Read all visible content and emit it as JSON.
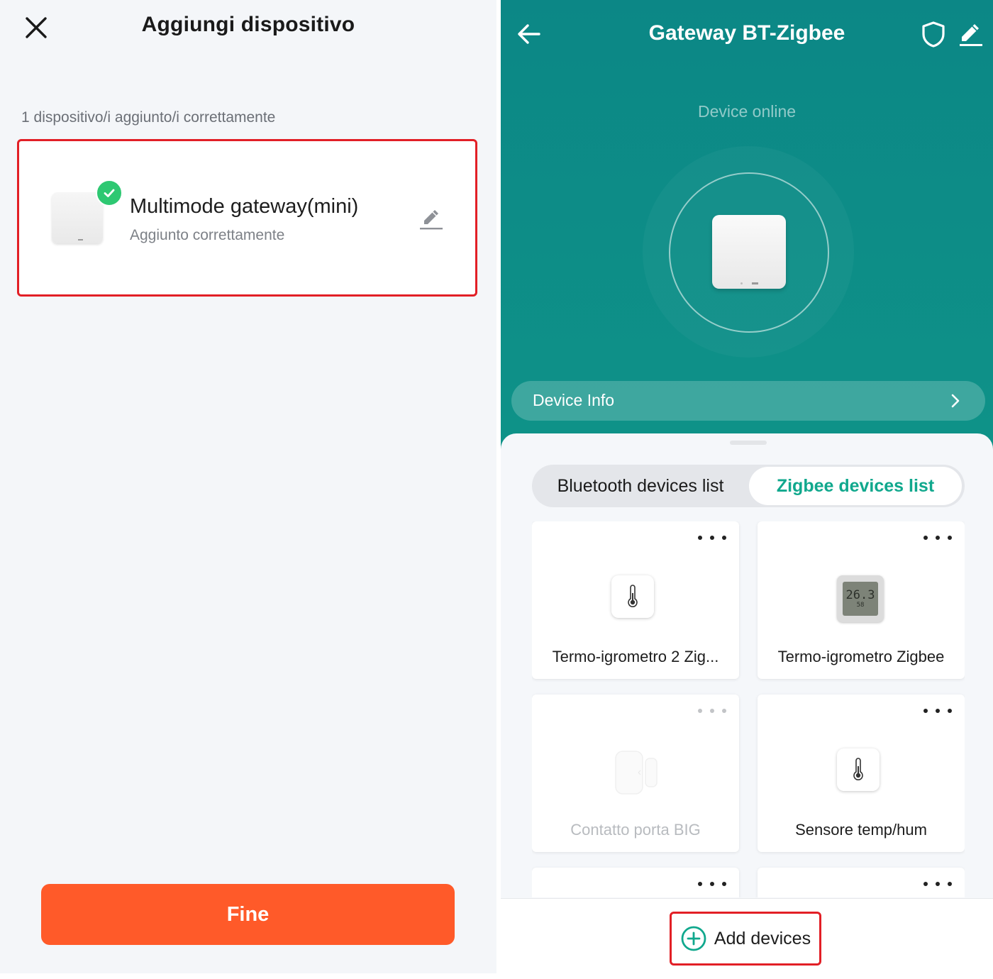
{
  "left_screen": {
    "title": "Aggiungi dispositivo",
    "close_icon": "close-icon",
    "success_message": "1 dispositivo/i aggiunto/i correttamente",
    "device": {
      "name": "Multimode gateway(mini)",
      "status": "Aggiunto correttamente",
      "badge_icon": "check-icon",
      "edit_icon": "pencil-icon"
    },
    "done_button": "Fine",
    "colors": {
      "accent": "#ff5a29",
      "success": "#2ec872",
      "highlight": "#e21f26"
    }
  },
  "right_screen": {
    "title": "Gateway BT-Zigbee",
    "icons": {
      "back": "arrow-left-icon",
      "shield": "shield-icon",
      "edit": "pencil-icon"
    },
    "status": "Device online",
    "device_info_label": "Device Info",
    "tabs": [
      {
        "label": "Bluetooth devices list",
        "active": false
      },
      {
        "label": "Zigbee devices list",
        "active": true
      }
    ],
    "devices": [
      {
        "name": "Termo-igrometro 2 Zig...",
        "icon": "thermometer-icon",
        "online": true
      },
      {
        "name": "Termo-igrometro Zigbee",
        "icon": "lcd-sensor-icon",
        "online": true,
        "lcd_temp": "26.3",
        "lcd_hum": "58"
      },
      {
        "name": "Contatto porta BIG",
        "icon": "door-sensor-icon",
        "online": false
      },
      {
        "name": "Sensore temp/hum",
        "icon": "thermometer-icon",
        "online": true
      }
    ],
    "add_button": "Add devices",
    "colors": {
      "header_bg": "#0c8786",
      "accent": "#10a88d",
      "highlight": "#e21f26"
    }
  }
}
